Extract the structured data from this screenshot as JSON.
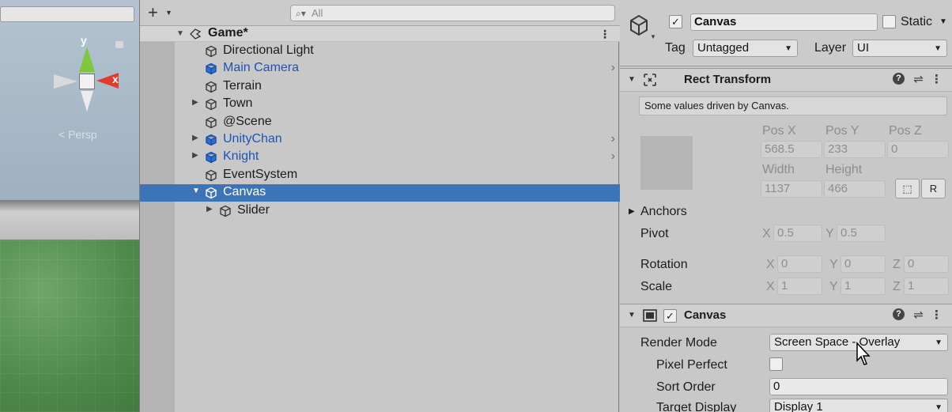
{
  "scene_view": {
    "axis_y": "y",
    "axis_x": "x",
    "persp_label": "< Persp"
  },
  "hierarchy": {
    "search_placeholder": "All",
    "scene_name": "Game*",
    "items": [
      {
        "label": "Directional Light",
        "prefab": false,
        "foldout": false,
        "indent": 0,
        "more": false
      },
      {
        "label": "Main Camera",
        "prefab": true,
        "foldout": false,
        "indent": 0,
        "more": true
      },
      {
        "label": "Terrain",
        "prefab": false,
        "foldout": false,
        "indent": 0,
        "more": false
      },
      {
        "label": "Town",
        "prefab": false,
        "foldout": true,
        "indent": 0,
        "more": false
      },
      {
        "label": "@Scene",
        "prefab": false,
        "foldout": false,
        "indent": 0,
        "more": false
      },
      {
        "label": "UnityChan",
        "prefab": true,
        "foldout": true,
        "indent": 0,
        "more": true
      },
      {
        "label": "Knight",
        "prefab": true,
        "foldout": true,
        "indent": 0,
        "more": true
      },
      {
        "label": "EventSystem",
        "prefab": false,
        "foldout": false,
        "indent": 0,
        "more": false
      },
      {
        "label": "Canvas",
        "prefab": false,
        "foldout": "open",
        "indent": 0,
        "more": false,
        "selected": true
      },
      {
        "label": "Slider",
        "prefab": false,
        "foldout": true,
        "indent": 1,
        "more": false
      }
    ]
  },
  "inspector": {
    "object_name": "Canvas",
    "static_label": "Static",
    "tag_label": "Tag",
    "tag_value": "Untagged",
    "layer_label": "Layer",
    "layer_value": "UI",
    "rect_transform": {
      "title": "Rect Transform",
      "info": "Some values driven by Canvas.",
      "pos_x_label": "Pos X",
      "pos_y_label": "Pos Y",
      "pos_z_label": "Pos Z",
      "pos_x": "568.5",
      "pos_y": "233",
      "pos_z": "0",
      "width_label": "Width",
      "height_label": "Height",
      "width": "1137",
      "height": "466",
      "r_button": "R",
      "anchors_label": "Anchors",
      "pivot_label": "Pivot",
      "pivot_x": "0.5",
      "pivot_y": "0.5",
      "rotation_label": "Rotation",
      "rotation_x": "0",
      "rotation_y": "0",
      "rotation_z": "0",
      "scale_label": "Scale",
      "scale_x": "1",
      "scale_y": "1",
      "scale_z": "1",
      "x": "X",
      "y": "Y",
      "z": "Z"
    },
    "canvas": {
      "title": "Canvas",
      "render_mode_label": "Render Mode",
      "render_mode_value": "Screen Space - Overlay",
      "pixel_perfect_label": "Pixel Perfect",
      "sort_order_label": "Sort Order",
      "sort_order_value": "0",
      "target_display_label": "Target Display",
      "target_display_value": "Display 1"
    },
    "help_glyph": "?"
  },
  "colors": {
    "selection": "#3c74b8",
    "prefab_text": "#1b55b5"
  }
}
